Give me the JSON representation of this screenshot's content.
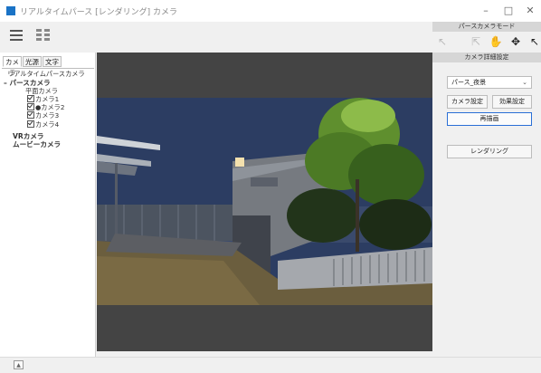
{
  "window": {
    "title": "リアルタイムパース [レンダリング] カメラ",
    "controls": [
      "–",
      "□",
      "✕"
    ]
  },
  "toolbar": {
    "menu_icon": "hamburger-icon",
    "layout_icon": "grid-icon"
  },
  "left_panel": {
    "tabs": [
      "カメラ",
      "光源",
      "文字"
    ],
    "tree": [
      {
        "label": "リアルタイムパースカメラ",
        "bold": false,
        "check": false
      },
      {
        "label": "パースカメラ",
        "bold": true,
        "check": false
      },
      {
        "label": "平面カメラ",
        "bold": false,
        "check": false
      },
      {
        "label": "カメラ1",
        "bold": false,
        "check": true
      },
      {
        "label": "●カメラ2",
        "bold": false,
        "check": true
      },
      {
        "label": "カメラ3",
        "bold": false,
        "check": true
      },
      {
        "label": "カメラ4",
        "bold": false,
        "check": true
      },
      {
        "label": "VRカメラ",
        "bold": true,
        "check": false
      },
      {
        "label": "ムービーカメラ",
        "bold": true,
        "check": false
      }
    ]
  },
  "right_panel": {
    "mode_header": "パースカメラモード",
    "tool_icons": [
      "pointer-icon",
      "select-icon",
      "hand-icon",
      "move-icon",
      "camera-pointer-icon"
    ],
    "detail_header": "カメラ詳細設定",
    "camera_select": "パース_夜景",
    "camera_settings_btn": "カメラ設定",
    "effect_settings_btn": "効果設定",
    "redraw_btn": "再描画",
    "render_btn": "レンダリング"
  },
  "colors": {
    "accent": "#2a6fd6",
    "viewport_bg": "#444444",
    "night_sky": "#2c3d62"
  }
}
